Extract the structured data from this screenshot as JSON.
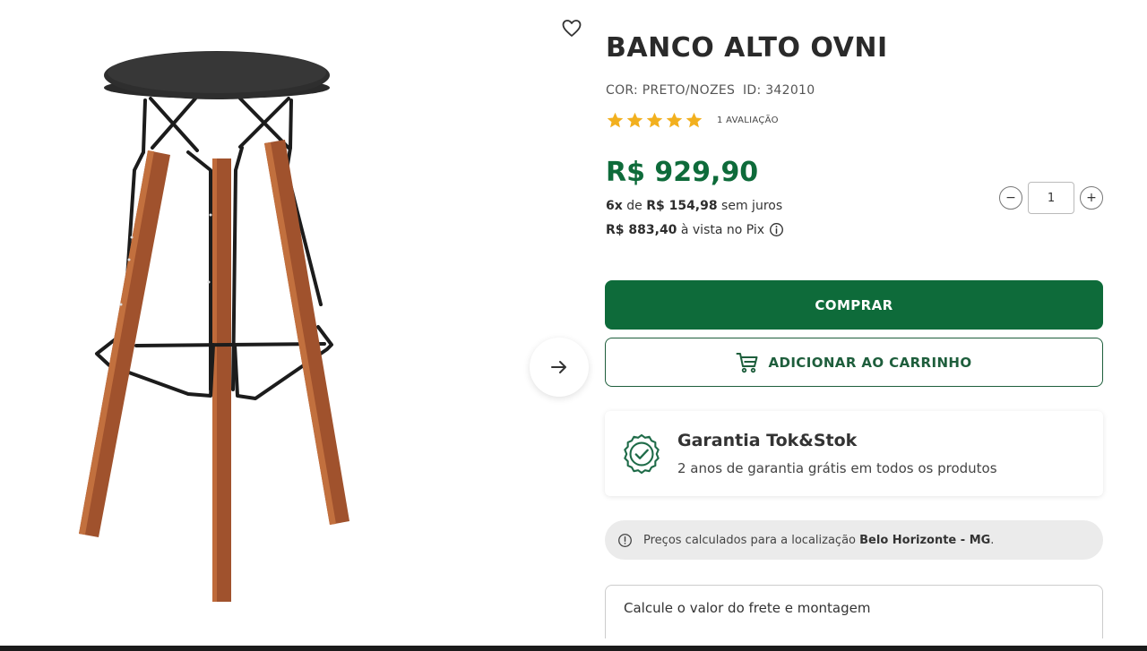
{
  "product": {
    "title": "BANCO ALTO OVNI",
    "color_label": "COR: PRETO/NOZES",
    "id_label": "ID: 342010",
    "rating": 5,
    "rating_count": "1 AVALIAÇÃO",
    "price": "R$ 929,90",
    "installments": {
      "prefix": "6x",
      "de": " de ",
      "amount": "R$ 154,98",
      "suffix": " sem juros"
    },
    "pix": {
      "amount": "R$ 883,40",
      "suffix": " à vista no Pix"
    }
  },
  "quantity": {
    "minus": "−",
    "value": "1",
    "plus": "+"
  },
  "actions": {
    "buy_label": "COMPRAR",
    "cart_label": "ADICIONAR AO CARRINHO"
  },
  "warranty": {
    "title": "Garantia Tok&Stok",
    "description": "2 anos de garantia grátis em todos os produtos"
  },
  "location": {
    "prefix": "Preços calculados para a localização ",
    "city": "Belo Horizonte - MG",
    "suffix": "."
  },
  "freight": {
    "label": "Calcule o valor do frete e montagem"
  },
  "icons": {
    "favorite": "heart-icon",
    "next": "arrow-right-icon",
    "cart": "cart-icon",
    "warranty": "badge-check-icon",
    "info": "info-icon"
  },
  "colors": {
    "brand_green": "#0e6b3a",
    "star": "#f2b01e",
    "text_dark": "#2d2d2d",
    "location_bg": "#ebebeb"
  }
}
